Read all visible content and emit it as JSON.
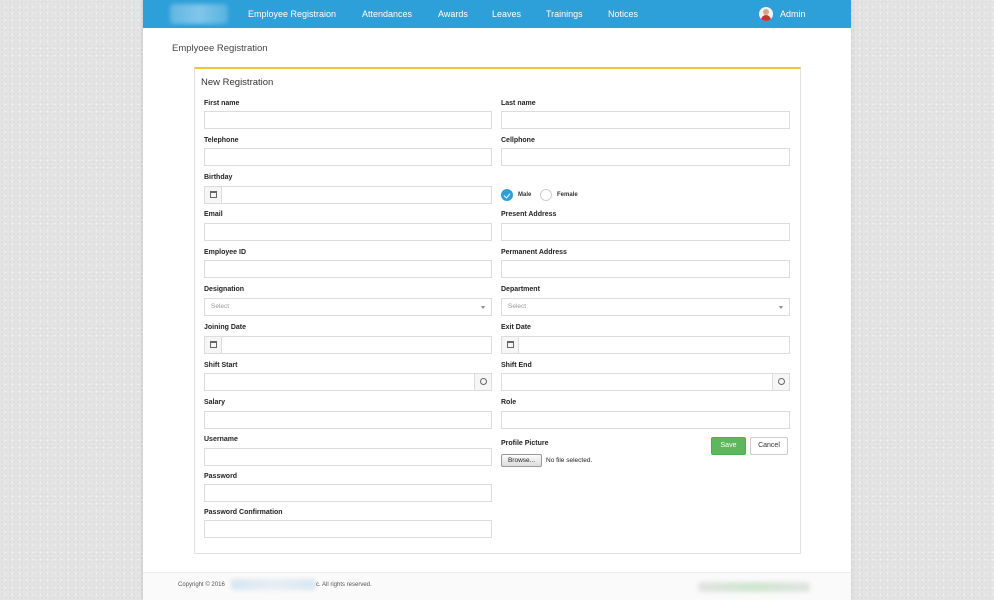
{
  "nav": {
    "items": [
      "Employee Registraion",
      "Attendances",
      "Awards",
      "Leaves",
      "Trainings",
      "Notices"
    ],
    "user": "Admin",
    "brand_color": "#2d9fd9"
  },
  "page_title": "Emplyoee Registration",
  "panel": {
    "title": "New Registration",
    "accent_color": "#f2c434"
  },
  "form": {
    "first_name": {
      "label": "First name",
      "value": ""
    },
    "last_name": {
      "label": "Last name",
      "value": ""
    },
    "telephone": {
      "label": "Telephone",
      "value": ""
    },
    "cellphone": {
      "label": "Cellphone",
      "value": ""
    },
    "birthday": {
      "label": "Birthday",
      "value": "",
      "icon": "calendar-icon"
    },
    "gender": {
      "options": [
        "Male",
        "Female"
      ],
      "selected": "Male"
    },
    "email": {
      "label": "Email",
      "value": ""
    },
    "present_address": {
      "label": "Present Address",
      "value": ""
    },
    "employee_id": {
      "label": "Employee ID",
      "value": ""
    },
    "permanent_address": {
      "label": "Permanent Address",
      "value": ""
    },
    "designation": {
      "label": "Designation",
      "selected": "Select"
    },
    "department": {
      "label": "Department",
      "selected": "Select"
    },
    "joining_date": {
      "label": "Joining Date",
      "value": "",
      "icon": "calendar-icon"
    },
    "exit_date": {
      "label": "Exit Date",
      "value": "",
      "icon": "calendar-icon"
    },
    "shift_start": {
      "label": "Shift Start",
      "value": "",
      "icon": "clock-icon"
    },
    "shift_end": {
      "label": "Shift End",
      "value": "",
      "icon": "clock-icon"
    },
    "salary": {
      "label": "Salary",
      "value": ""
    },
    "role": {
      "label": "Role",
      "value": ""
    },
    "username": {
      "label": "Username",
      "value": ""
    },
    "profile_picture": {
      "label": "Profile Picture",
      "browse_label": "Browse...",
      "file_status": "No file selected."
    },
    "password": {
      "label": "Password",
      "value": ""
    },
    "password_confirmation": {
      "label": "Password Confirmation",
      "value": ""
    }
  },
  "actions": {
    "save": "Save",
    "cancel": "Cancel",
    "save_color": "#5cb85c"
  },
  "footer": {
    "copyright": "Copyright © 2016",
    "rights": "c. All rights reserved."
  }
}
